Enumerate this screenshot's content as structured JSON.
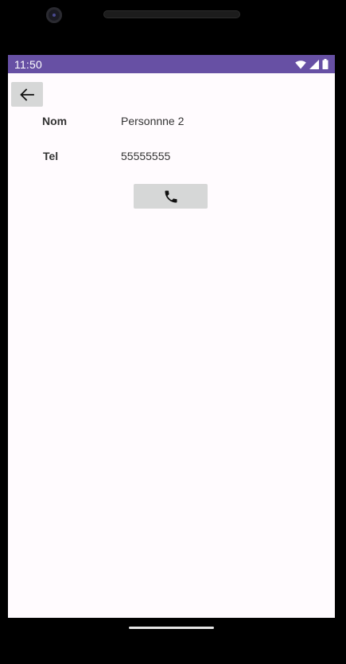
{
  "status_bar": {
    "time": "11:50",
    "background_color": "#6750a4",
    "icons": [
      "wifi-icon",
      "signal-icon",
      "battery-icon"
    ]
  },
  "toolbar": {
    "back_icon": "arrow-left-icon"
  },
  "contact": {
    "name_label": "Nom",
    "name_value": "Personnne 2",
    "tel_label": "Tel",
    "tel_value": "55555555"
  },
  "actions": {
    "call_icon": "phone-icon"
  }
}
